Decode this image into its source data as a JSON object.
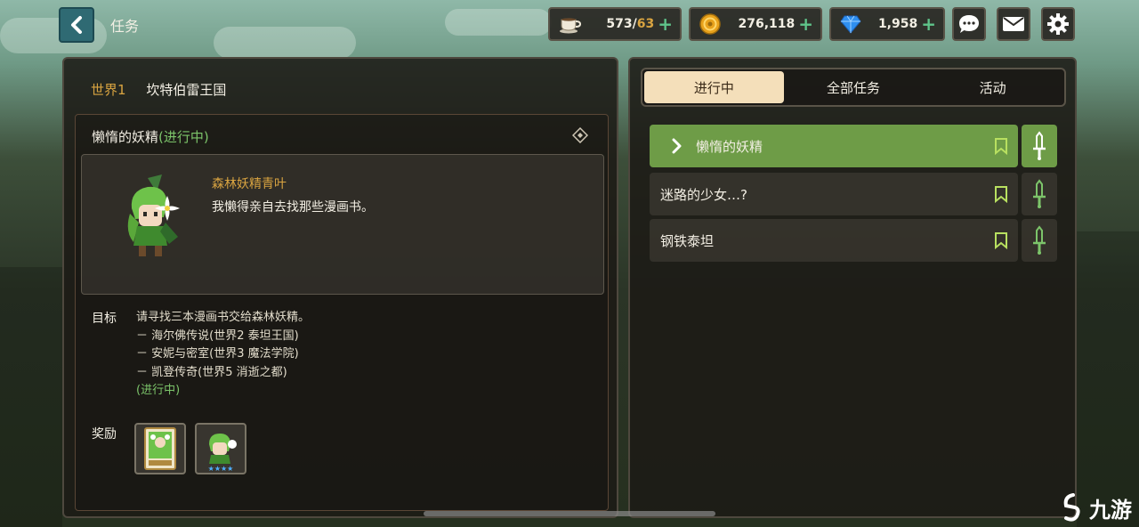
{
  "header": {
    "title": "任务",
    "back_icon": "chevron-left-icon"
  },
  "resources": {
    "stamina": {
      "icon": "coffee-cup-icon",
      "current": "573",
      "separator": "/",
      "max": "63",
      "plus": "+"
    },
    "gold": {
      "icon": "gold-coin-icon",
      "value": "276,118",
      "plus": "+"
    },
    "gems": {
      "icon": "diamond-gem-icon",
      "value": "1,958",
      "plus": "+"
    }
  },
  "toolbar": {
    "chat_icon": "chat-bubble-icon",
    "mail_icon": "mail-envelope-icon",
    "settings_icon": "gear-icon"
  },
  "left": {
    "world": "世界1",
    "kingdom": "坎特伯雷王国",
    "quest_title": "懒惰的妖精",
    "quest_status": "(进行中)",
    "npc_name": "森林妖精青叶",
    "npc_line": "我懒得亲自去找那些漫画书。",
    "objective_label": "目标",
    "objective_main": "请寻找三本漫画书交给森林妖精。",
    "objective_items": [
      "－ 海尔佛传说(世界2  泰坦王国)",
      "－ 安妮与密室(世界3  魔法学院)",
      "－ 凯登传奇(世界5  消逝之都)"
    ],
    "objective_status": "(进行中)",
    "reward_label": "奖励"
  },
  "right": {
    "tabs": [
      "进行中",
      "全部任务",
      "活动"
    ],
    "active_tab": 0,
    "quests": [
      {
        "label": "懒惰的妖精",
        "active": true
      },
      {
        "label": "迷路的少女…?",
        "active": false
      },
      {
        "label": "钢铁泰坦",
        "active": false
      }
    ]
  },
  "colors": {
    "accent_gold": "#d9a441",
    "status_green": "#7cc46a",
    "active_row": "#6e9c47",
    "tab_active": "#f4dfba"
  },
  "watermark": {
    "text": "九游"
  }
}
